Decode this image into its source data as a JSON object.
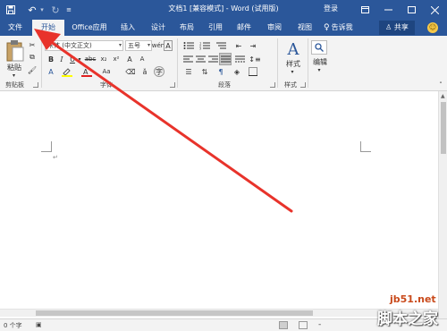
{
  "window": {
    "title": "文档1 [兼容模式] - Word (试用版)",
    "login": "登录"
  },
  "tabs": {
    "file": "文件",
    "home": "开始",
    "office_apps": "Office应用",
    "insert": "插入",
    "design": "设计",
    "layout": "布局",
    "references": "引用",
    "mailings": "邮件",
    "review": "审阅",
    "view": "视图",
    "tell_me": "告诉我",
    "share": "共享"
  },
  "ribbon": {
    "paste_label": "粘贴",
    "clipboard_label": "剪贴板",
    "font_label": "字体",
    "paragraph_label": "段落",
    "styles_label": "样式",
    "styles_btn": "样式",
    "editing_btn": "编辑",
    "font_name": "宋体 (中文正文)",
    "font_size": "五号",
    "bold": "B",
    "italic": "I",
    "underline": "U",
    "strike": "abc",
    "subscript": "x₂",
    "superscript": "x²",
    "font_color_a": "A",
    "aa": "Aa",
    "grow": "A",
    "shrink": "A",
    "wen": "wén",
    "clear_a": "A"
  },
  "status": {
    "word_count": "0 个字",
    "zoom_minus": "-"
  },
  "watermark": {
    "line1": "jb51.net",
    "line2": "脚本之家"
  },
  "colors": {
    "brand": "#2b579a",
    "ribbon_bg": "#f3f3f3",
    "arrow": "#e8332b"
  }
}
